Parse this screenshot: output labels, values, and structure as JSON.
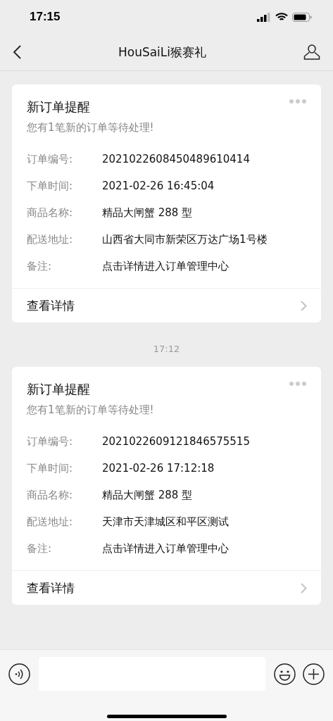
{
  "status_bar": {
    "time": "17:15"
  },
  "nav": {
    "title": "HouSaiLi猴赛礼"
  },
  "messages": [
    {
      "kind": "card",
      "title": "新订单提醒",
      "subtitle": "您有1笔新的订单等待处理!",
      "fields": [
        {
          "label": "订单编号:",
          "value": "2021022608450489610414"
        },
        {
          "label": "下单时间:",
          "value": "2021-02-26 16:45:04"
        },
        {
          "label": "商品名称:",
          "value": "精品大闸蟹 288 型"
        },
        {
          "label": "配送地址:",
          "value": "山西省大同市新荣区万达广场1号楼"
        },
        {
          "label": "备注:",
          "value": "点击详情进入订单管理中心"
        }
      ],
      "footer": "查看详情"
    },
    {
      "kind": "time",
      "text": "17:12"
    },
    {
      "kind": "card",
      "title": "新订单提醒",
      "subtitle": "您有1笔新的订单等待处理!",
      "fields": [
        {
          "label": "订单编号:",
          "value": "2021022609121846575515"
        },
        {
          "label": "下单时间:",
          "value": "2021-02-26 17:12:18"
        },
        {
          "label": "商品名称:",
          "value": "精品大闸蟹 288 型"
        },
        {
          "label": "配送地址:",
          "value": "天津市天津城区和平区测试"
        },
        {
          "label": "备注:",
          "value": "点击详情进入订单管理中心"
        }
      ],
      "footer": "查看详情"
    }
  ]
}
